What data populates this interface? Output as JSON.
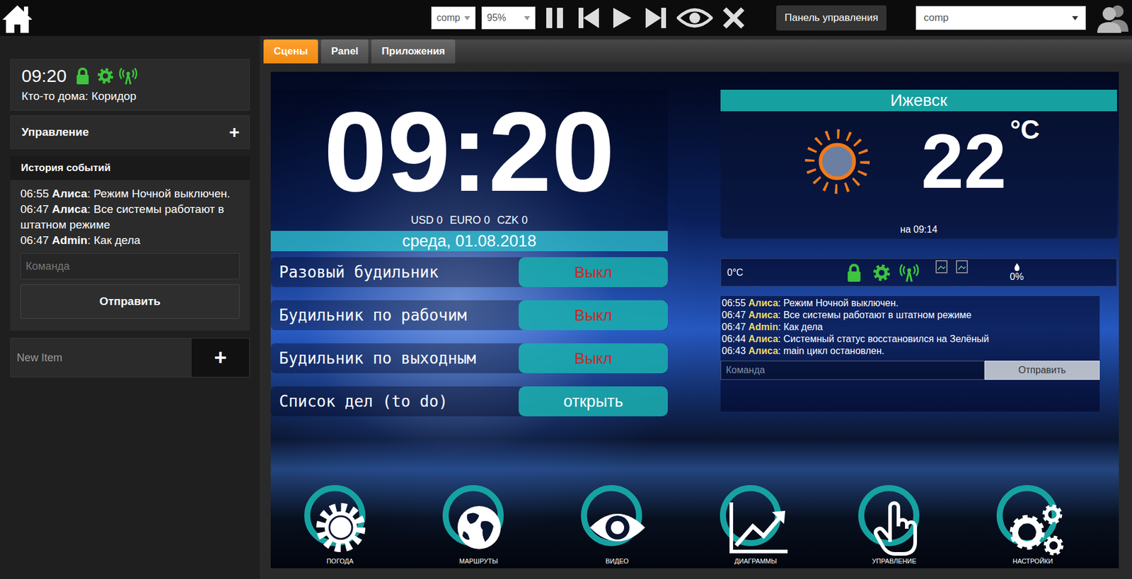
{
  "top_bar": {
    "selects": [
      {
        "value": "comp"
      },
      {
        "value": "95%"
      }
    ],
    "panel_button": "Панель управления",
    "user_select": {
      "value": "comp"
    }
  },
  "sidebar": {
    "clock": "09:20",
    "presence": "Кто-то дома: Коридор",
    "control": {
      "title": "Управление",
      "toggle": "+"
    },
    "history": {
      "title": "История событий",
      "events": [
        {
          "time": "06:55",
          "user": "Алиса",
          "text": ": Режим Ночной выключен."
        },
        {
          "time": "06:47",
          "user": "Алиса",
          "text": ": Все системы работают в штатном режиме"
        },
        {
          "time": "06:47",
          "user": "Admin",
          "text": ": Как дела"
        }
      ],
      "command_placeholder": "Команда",
      "send_button": "Отправить"
    },
    "new_item": {
      "placeholder": "New Item",
      "add_button": "+"
    }
  },
  "tabs": [
    {
      "label": "Сцены",
      "selected": true
    },
    {
      "label": "Panel",
      "selected": false
    },
    {
      "label": "Приложения",
      "selected": false
    }
  ],
  "scene": {
    "clock": "09:20",
    "currency": [
      {
        "code": "USD",
        "value": "0"
      },
      {
        "code": "EURO",
        "value": "0"
      },
      {
        "code": "CZK",
        "value": "0"
      }
    ],
    "date": "среда, 01.08.2018",
    "rows": [
      {
        "label": "Разовый будильник",
        "button": "Выкл",
        "kind": "toggle"
      },
      {
        "label": "Будильник по рабочим",
        "button": "Выкл",
        "kind": "toggle"
      },
      {
        "label": "Будильник по выходным",
        "button": "Выкл",
        "kind": "toggle"
      },
      {
        "label": "Список дел (to do)",
        "button": "открыть",
        "kind": "link"
      }
    ],
    "weather": {
      "city": "Ижевск",
      "temperature": "22",
      "unit": "°C",
      "updated": "на 09:14"
    },
    "status": {
      "temperature": "0°C",
      "humidity": "0%"
    },
    "chat": {
      "messages": [
        {
          "time": "06:55",
          "user": "Алиса",
          "text": ": Режим Ночной выключен."
        },
        {
          "time": "06:47",
          "user": "Алиса",
          "text": ": Все системы работают в штатном режиме"
        },
        {
          "time": "06:47",
          "user": "Admin",
          "text": ": Как дела"
        },
        {
          "time": "06:44",
          "user": "Алиса",
          "text": ": Системный статус восстановился на Зелёный"
        },
        {
          "time": "06:43",
          "user": "Алиса",
          "text": ": main цикл остановлен."
        }
      ],
      "placeholder": "Команда",
      "send_button": "Отправить"
    },
    "nav": [
      {
        "label": "ПОГОДА",
        "kind": "weather"
      },
      {
        "label": "МАРШРУТЫ",
        "kind": "routes"
      },
      {
        "label": "ВИДЕО",
        "kind": "video"
      },
      {
        "label": "ДИАГРАММЫ",
        "kind": "charts"
      },
      {
        "label": "УПРАВЛЕНИЕ",
        "kind": "control"
      },
      {
        "label": "НАСТРОЙКИ",
        "kind": "settings"
      }
    ]
  }
}
